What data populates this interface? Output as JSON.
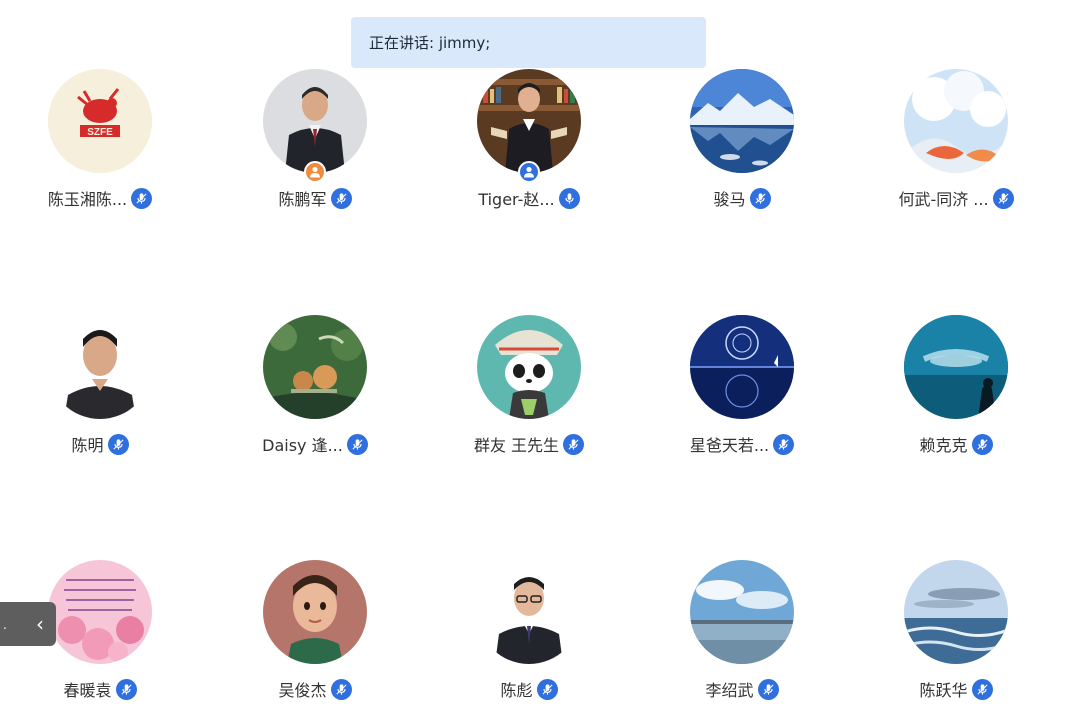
{
  "speaking": {
    "text": "正在讲话: jimmy;"
  },
  "participants": [
    {
      "name": "陈玉湘陈...",
      "avatar": "szfe-logo-avatar",
      "mic_active": true
    },
    {
      "name": "陈鹏军",
      "avatar": "man-suit-photo-avatar",
      "mic_active": true,
      "host_badge": "person-icon",
      "host_badge_color": "#f08a3c"
    },
    {
      "name": "Tiger-赵...",
      "avatar": "man-library-photo-avatar",
      "mic_active": false,
      "host_badge": "person-icon",
      "host_badge_color": "#2f6fde"
    },
    {
      "name": "骏马",
      "avatar": "glacier-landscape-avatar",
      "mic_active": true
    },
    {
      "name": "何武-同济 ...",
      "avatar": "sky-koi-avatar",
      "mic_active": true
    },
    {
      "name": "陈明",
      "avatar": "man-portrait-avatar",
      "mic_active": true
    },
    {
      "name": "Daisy 逢...",
      "avatar": "snails-avatar",
      "mic_active": true
    },
    {
      "name": "群友 王先生",
      "avatar": "panda-illustration-avatar",
      "mic_active": true
    },
    {
      "name": "星爸天若...",
      "avatar": "night-reflection-avatar",
      "mic_active": true
    },
    {
      "name": "赖克克",
      "avatar": "aquarium-avatar",
      "mic_active": true
    },
    {
      "name": "春暖袁",
      "avatar": "cherry-blossom-avatar",
      "mic_active": true
    },
    {
      "name": "吴俊杰",
      "avatar": "cartoon-boy-avatar",
      "mic_active": true
    },
    {
      "name": "陈彪",
      "avatar": "man-glasses-avatar",
      "mic_active": true
    },
    {
      "name": "李绍武",
      "avatar": "seaside-sky-avatar",
      "mic_active": true
    },
    {
      "name": "陈跃华",
      "avatar": "ocean-waves-avatar",
      "mic_active": true
    }
  ],
  "colors": {
    "accent": "#2f6fde",
    "banner": "#d9e8fb"
  },
  "nav": {
    "prev_icon": "‹",
    "prev_hint": "."
  }
}
